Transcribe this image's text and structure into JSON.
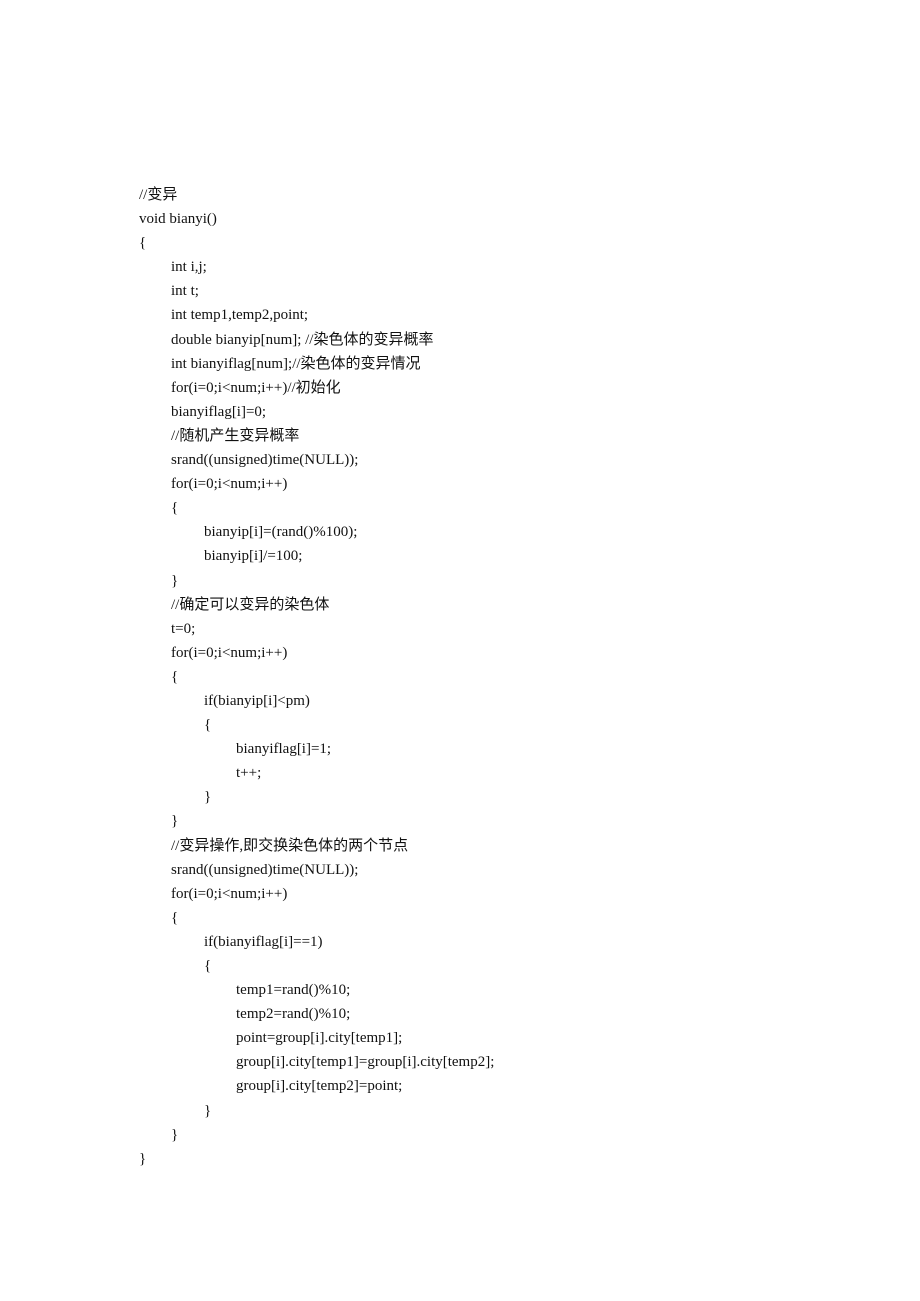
{
  "document": {
    "code": [
      {
        "indent": 0,
        "text": "//变异"
      },
      {
        "indent": 0,
        "text": "void bianyi()"
      },
      {
        "indent": 0,
        "text": "{"
      },
      {
        "indent": 1,
        "text": "int i,j;"
      },
      {
        "indent": 1,
        "text": "int t;"
      },
      {
        "indent": 1,
        "text": "int temp1,temp2,point;"
      },
      {
        "indent": 1,
        "text": "double bianyip[num]; //染色体的变异概率"
      },
      {
        "indent": 1,
        "text": "int bianyiflag[num];//染色体的变异情况"
      },
      {
        "indent": 1,
        "text": "for(i=0;i<num;i++)//初始化"
      },
      {
        "indent": 1,
        "text": "bianyiflag[i]=0;"
      },
      {
        "indent": 1,
        "text": "//随机产生变异概率"
      },
      {
        "indent": 1,
        "text": "srand((unsigned)time(NULL));"
      },
      {
        "indent": 1,
        "text": "for(i=0;i<num;i++)"
      },
      {
        "indent": 1,
        "text": "{"
      },
      {
        "indent": 2,
        "text": "bianyip[i]=(rand()%100);"
      },
      {
        "indent": 2,
        "text": "bianyip[i]/=100;"
      },
      {
        "indent": 1,
        "text": "}"
      },
      {
        "indent": 1,
        "text": "//确定可以变异的染色体"
      },
      {
        "indent": 1,
        "text": "t=0;"
      },
      {
        "indent": 1,
        "text": "for(i=0;i<num;i++)"
      },
      {
        "indent": 1,
        "text": "{"
      },
      {
        "indent": 2,
        "text": "if(bianyip[i]<pm)"
      },
      {
        "indent": 2,
        "text": "{"
      },
      {
        "indent": 3,
        "text": "bianyiflag[i]=1;"
      },
      {
        "indent": 3,
        "text": "t++;"
      },
      {
        "indent": 2,
        "text": "}"
      },
      {
        "indent": 1,
        "text": "}"
      },
      {
        "indent": 1,
        "text": "//变异操作,即交换染色体的两个节点"
      },
      {
        "indent": 1,
        "text": "srand((unsigned)time(NULL));"
      },
      {
        "indent": 1,
        "text": "for(i=0;i<num;i++)"
      },
      {
        "indent": 1,
        "text": "{"
      },
      {
        "indent": 2,
        "text": "if(bianyiflag[i]==1)"
      },
      {
        "indent": 2,
        "text": "{"
      },
      {
        "indent": 3,
        "text": "temp1=rand()%10;"
      },
      {
        "indent": 3,
        "text": "temp2=rand()%10;"
      },
      {
        "indent": 3,
        "text": "point=group[i].city[temp1];"
      },
      {
        "indent": 3,
        "text": "group[i].city[temp1]=group[i].city[temp2];"
      },
      {
        "indent": 3,
        "text": "group[i].city[temp2]=point;"
      },
      {
        "indent": 2,
        "text": "}"
      },
      {
        "indent": 1,
        "text": "}"
      },
      {
        "indent": 0,
        "text": "}"
      }
    ]
  }
}
